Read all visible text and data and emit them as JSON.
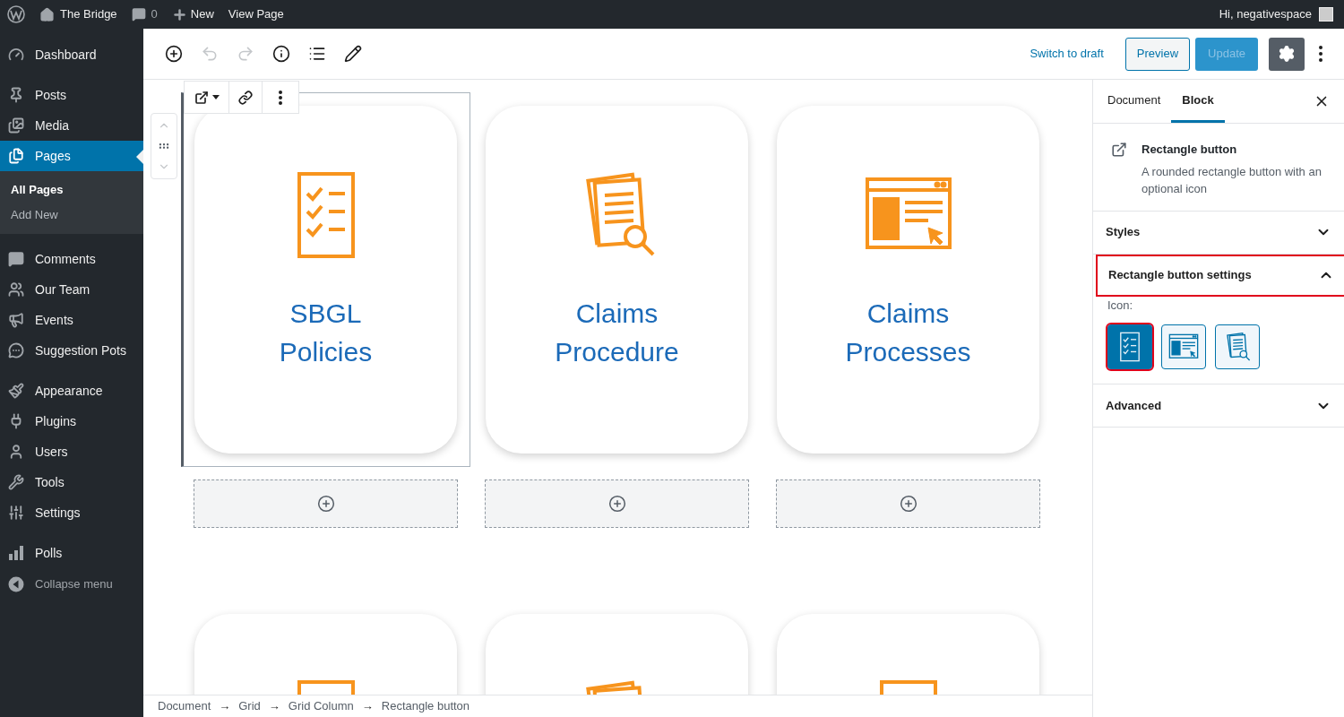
{
  "top_bar": {
    "site": "The Bridge",
    "comments": "0",
    "new": "New",
    "view": "View Page",
    "greeting": "Hi, negativespace"
  },
  "sidebar": {
    "groups": [
      {
        "items": [
          {
            "label": "Dashboard",
            "selected": false
          }
        ]
      },
      {
        "items": [
          {
            "label": "Posts",
            "selected": false
          },
          {
            "label": "Media",
            "selected": false
          },
          {
            "label": "Pages",
            "selected": true,
            "children": [
              {
                "label": "All Pages",
                "selected": true
              },
              {
                "label": "Add New",
                "selected": false
              }
            ]
          }
        ]
      },
      {
        "items": [
          {
            "label": "Comments",
            "selected": false
          },
          {
            "label": "Our Team",
            "selected": false
          },
          {
            "label": "Events",
            "selected": false
          },
          {
            "label": "Suggestion Pots",
            "selected": false
          }
        ]
      },
      {
        "items": [
          {
            "label": "Appearance",
            "selected": false
          },
          {
            "label": "Plugins",
            "selected": false
          },
          {
            "label": "Users",
            "selected": false
          },
          {
            "label": "Tools",
            "selected": false
          },
          {
            "label": "Settings",
            "selected": false
          }
        ]
      },
      {
        "items": [
          {
            "label": "Polls",
            "selected": false
          }
        ]
      }
    ],
    "collapse": "Collapse menu"
  },
  "header": {
    "tools": [
      {
        "disabled": false
      },
      {
        "disabled": true
      },
      {
        "disabled": true
      },
      {
        "disabled": false
      },
      {
        "disabled": false
      },
      {
        "disabled": false
      }
    ],
    "switch_to_draft": "Switch to draft",
    "preview": "Preview",
    "update": {
      "label": "Update",
      "disabled": true
    },
    "settings_pressed": true
  },
  "canvas": {
    "rows": [
      {
        "cards": [
          {
            "kind": "checklist",
            "title": "SBGL Policies",
            "selected": true
          },
          {
            "kind": "documents",
            "title": "Claims Procedure",
            "selected": false
          },
          {
            "kind": "browser",
            "title": "Claims Processes",
            "selected": false
          }
        ]
      },
      {
        "cards": [
          {
            "kind": "checklist",
            "selected": false
          },
          {
            "kind": "documents",
            "selected": false
          },
          {
            "kind": "checklist",
            "selected": false
          }
        ]
      }
    ]
  },
  "breadcrumb": [
    {
      "kind": "crumb",
      "label": "Document"
    },
    {
      "kind": "separator",
      "label": "→"
    },
    {
      "kind": "crumb",
      "label": "Grid"
    },
    {
      "kind": "separator",
      "label": "→"
    },
    {
      "kind": "crumb",
      "label": "Grid Column"
    },
    {
      "kind": "separator",
      "label": "→"
    },
    {
      "kind": "crumb",
      "label": "Rectangle button"
    }
  ],
  "inspector": {
    "tabs": [
      {
        "label": "Document",
        "selected": false
      },
      {
        "label": "Block",
        "selected": true
      }
    ],
    "block": {
      "title": "Rectangle button",
      "description": "A rounded rectangle button with an optional icon"
    },
    "panels": [
      {
        "title": "Styles",
        "expanded": false,
        "highlighted": false
      },
      {
        "title": "Rectangle button settings",
        "expanded": true,
        "highlighted": true,
        "field_label": "Icon:",
        "options": [
          {
            "kind": "checklist",
            "selected": true,
            "highlighted": true
          },
          {
            "kind": "browser",
            "selected": false,
            "highlighted": false
          },
          {
            "kind": "documents",
            "selected": false,
            "highlighted": false
          }
        ]
      },
      {
        "title": "Advanced",
        "expanded": false,
        "highlighted": false
      }
    ]
  }
}
